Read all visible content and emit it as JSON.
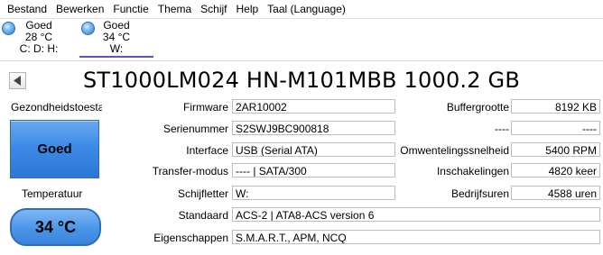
{
  "menu": [
    "Bestand",
    "Bewerken",
    "Functie",
    "Thema",
    "Schijf",
    "Help",
    "Taal (Language)"
  ],
  "drives": [
    {
      "status": "Goed",
      "temperature": "28 °C",
      "letters": "C: D: H:"
    },
    {
      "status": "Goed",
      "temperature": "34 °C",
      "letters": "W:"
    }
  ],
  "title": "ST1000LM024 HN-M101MBB 1000.2 GB",
  "left": {
    "health_label": "Gezondheidstoestand",
    "health_value": "Goed",
    "temperature_label": "Temperatuur",
    "temperature_value": "34 °C"
  },
  "details": {
    "firmware_label": "Firmware",
    "firmware_value": "2AR10002",
    "serial_label": "Serienummer",
    "serial_value": "S2SWJ9BC900818",
    "interface_label": "Interface",
    "interface_value": "USB (Serial ATA)",
    "transfer_label": "Transfer-modus",
    "transfer_value": "---- | SATA/300",
    "letter_label": "Schijfletter",
    "letter_value": "W:",
    "standard_label": "Standaard",
    "standard_value": "ACS-2 | ATA8-ACS version 6",
    "features_label": "Eigenschappen",
    "features_value": "S.M.A.R.T., APM, NCQ"
  },
  "right": {
    "buffer_label": "Buffergrootte",
    "buffer_value": "8192 KB",
    "blank_label": "----",
    "blank_value": "----",
    "rpm_label": "Omwentelingssnelheid",
    "rpm_value": "5400 RPM",
    "poweron_count_label": "Inschakelingen",
    "poweron_count_value": "4820 keer",
    "poweron_hours_label": "Bedrijfsuren",
    "poweron_hours_value": "4588 uren"
  },
  "colors": {
    "health_blue": "#3d8be6",
    "active_tab_underline": "#6b4fc6"
  }
}
